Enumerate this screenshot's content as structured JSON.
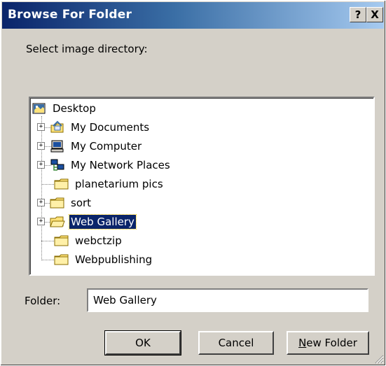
{
  "window": {
    "title": "Browse For Folder",
    "help_label": "?",
    "close_label": "X"
  },
  "prompt": "Select image directory:",
  "tree": {
    "items": [
      {
        "label": "Desktop",
        "icon": "desktop-icon"
      },
      {
        "label": "My Documents",
        "icon": "my-documents-icon"
      },
      {
        "label": "My Computer",
        "icon": "my-computer-icon"
      },
      {
        "label": "My Network Places",
        "icon": "network-places-icon"
      },
      {
        "label": "planetarium pics",
        "icon": "folder-icon"
      },
      {
        "label": "sort",
        "icon": "folder-icon"
      },
      {
        "label": "Web Gallery",
        "icon": "folder-open-icon",
        "selected": true
      },
      {
        "label": "webctzip",
        "icon": "folder-icon"
      },
      {
        "label": "Webpublishing",
        "icon": "folder-icon"
      }
    ]
  },
  "folder": {
    "label": "Folder:",
    "value": "Web Gallery"
  },
  "buttons": {
    "ok": "OK",
    "cancel": "Cancel",
    "new_folder_prefix": "N",
    "new_folder_rest": "ew Folder"
  },
  "colors": {
    "selection": "#0a246a",
    "title_start": "#0a246a",
    "title_end": "#a6caf0",
    "face": "#d4d0c8",
    "folder": "#ffe27a"
  }
}
